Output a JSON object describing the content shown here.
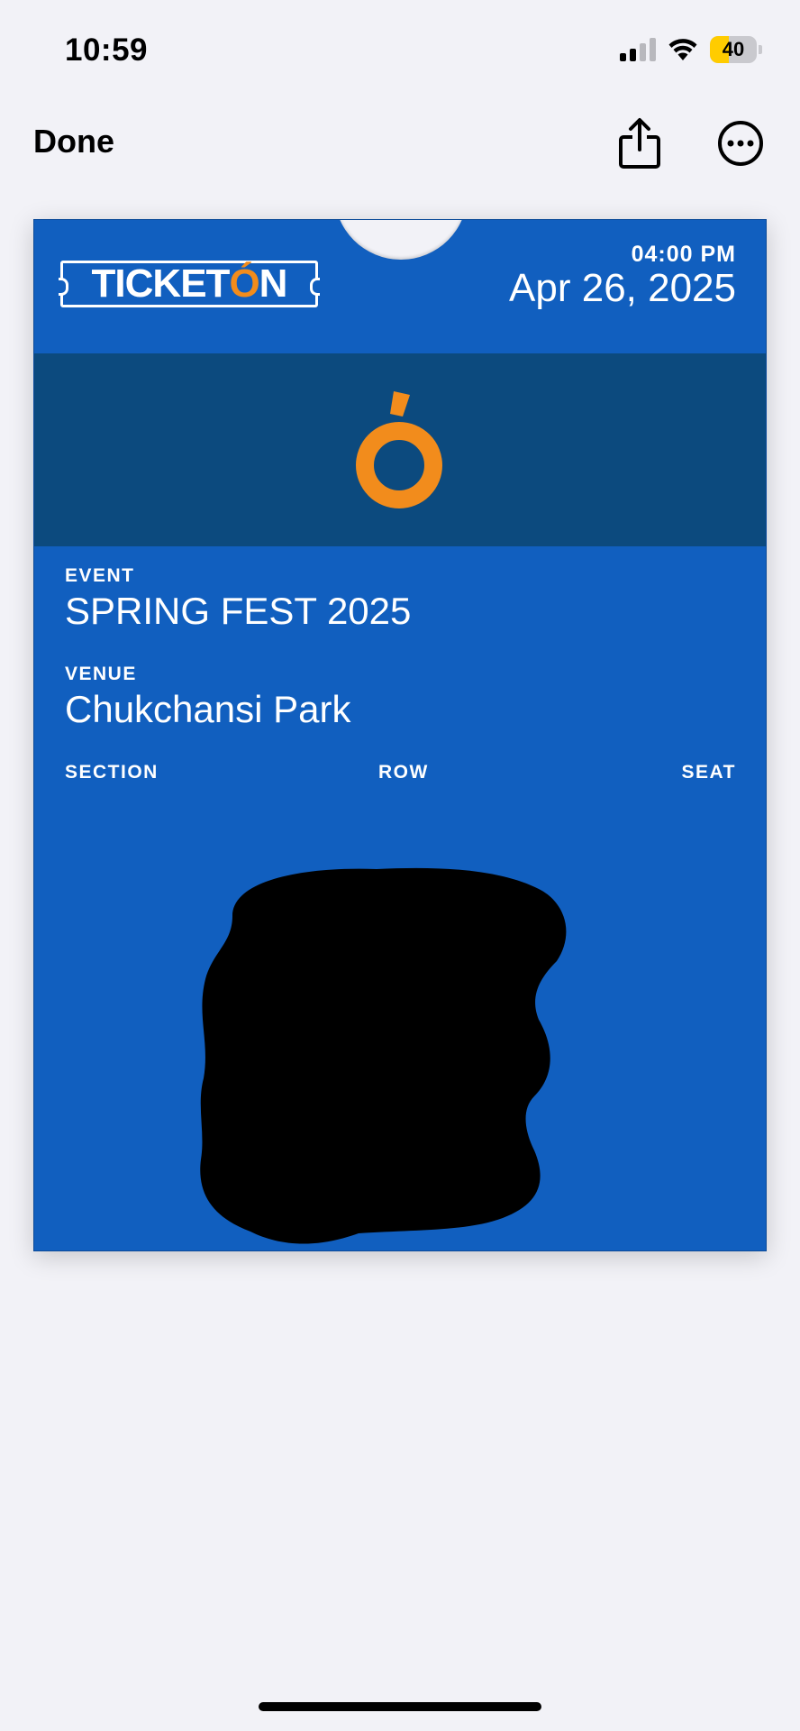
{
  "status_bar": {
    "time": "10:59",
    "battery_level": "40",
    "battery_color": "#ffcc00",
    "icons": [
      "cellular-signal-icon",
      "wifi-icon",
      "battery-icon"
    ]
  },
  "nav": {
    "done_label": "Done",
    "icons": [
      "share-icon",
      "more-icon"
    ]
  },
  "pass": {
    "background_color": "#115fbf",
    "strip_color": "#0c4a7e",
    "accent_color": "#f28c1c",
    "logo": {
      "text_main": "TICKET",
      "text_accent": "Ó",
      "text_end": "N"
    },
    "time": "04:00 PM",
    "date": "Apr 26, 2025",
    "event_label": "EVENT",
    "event_value": "SPRING FEST 2025",
    "venue_label": "VENUE",
    "venue_value": "Chukchansi Park",
    "section_label": "SECTION",
    "row_label": "ROW",
    "seat_label": "SEAT"
  }
}
